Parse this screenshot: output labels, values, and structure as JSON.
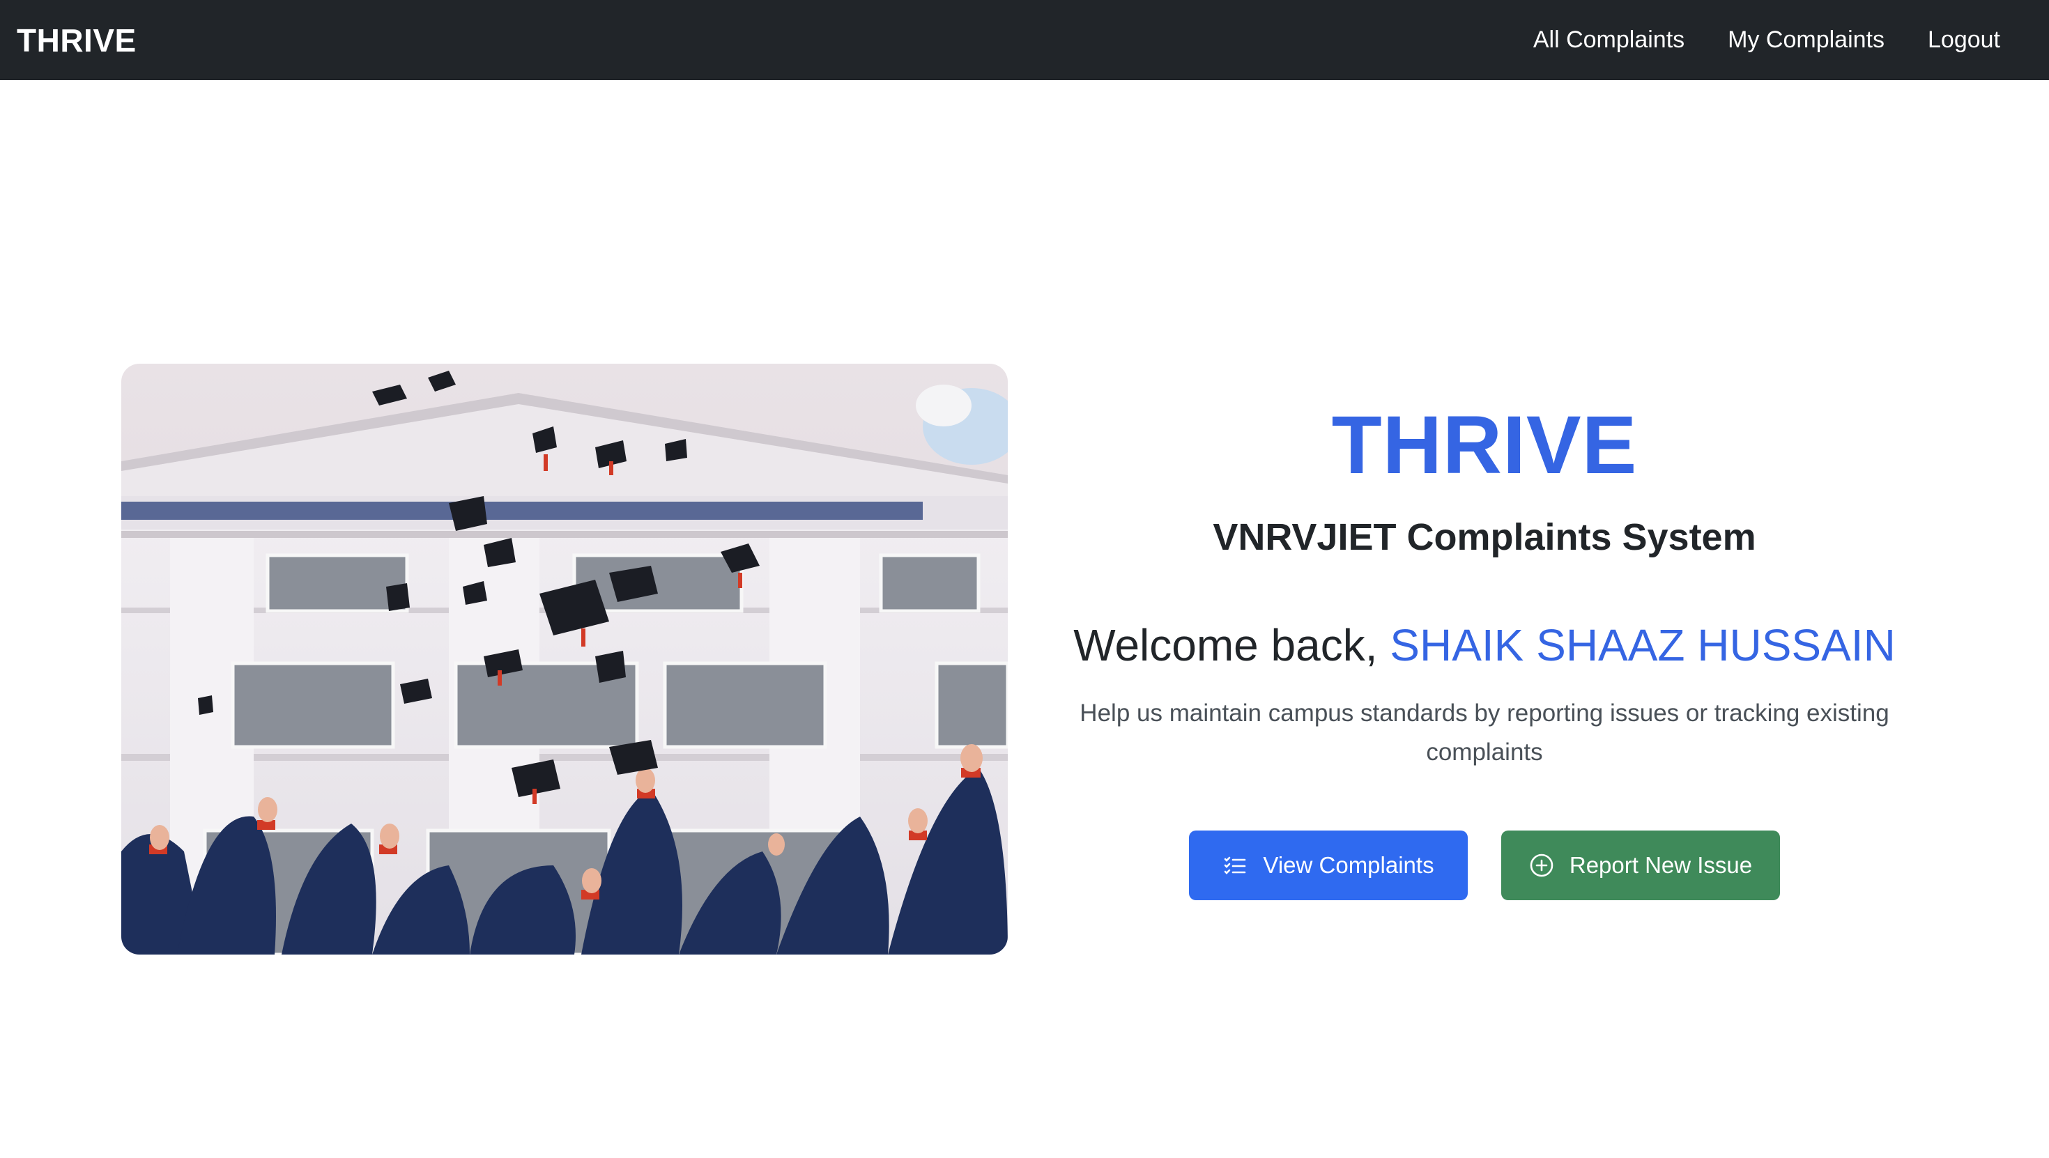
{
  "navbar": {
    "brand": "THRIVE",
    "links": [
      {
        "label": "All Complaints"
      },
      {
        "label": "My Complaints"
      },
      {
        "label": "Logout"
      }
    ]
  },
  "hero": {
    "image_alt": "Graduates throwing caps in front of university building",
    "title": "THRIVE",
    "subtitle": "VNRVJIET Complaints System",
    "welcome_prefix": "Welcome back,",
    "user_name": "SHAIK SHAAZ HUSSAIN",
    "description": "Help us maintain campus standards by reporting issues or tracking existing complaints",
    "buttons": {
      "view": {
        "label": "View Complaints",
        "icon": "list-check-icon"
      },
      "report": {
        "label": "Report New Issue",
        "icon": "plus-circle-icon"
      }
    }
  },
  "colors": {
    "navbar_bg": "#212529",
    "accent": "#3565e3",
    "primary_button": "#2f6af0",
    "success_button": "#3f8a5a"
  }
}
